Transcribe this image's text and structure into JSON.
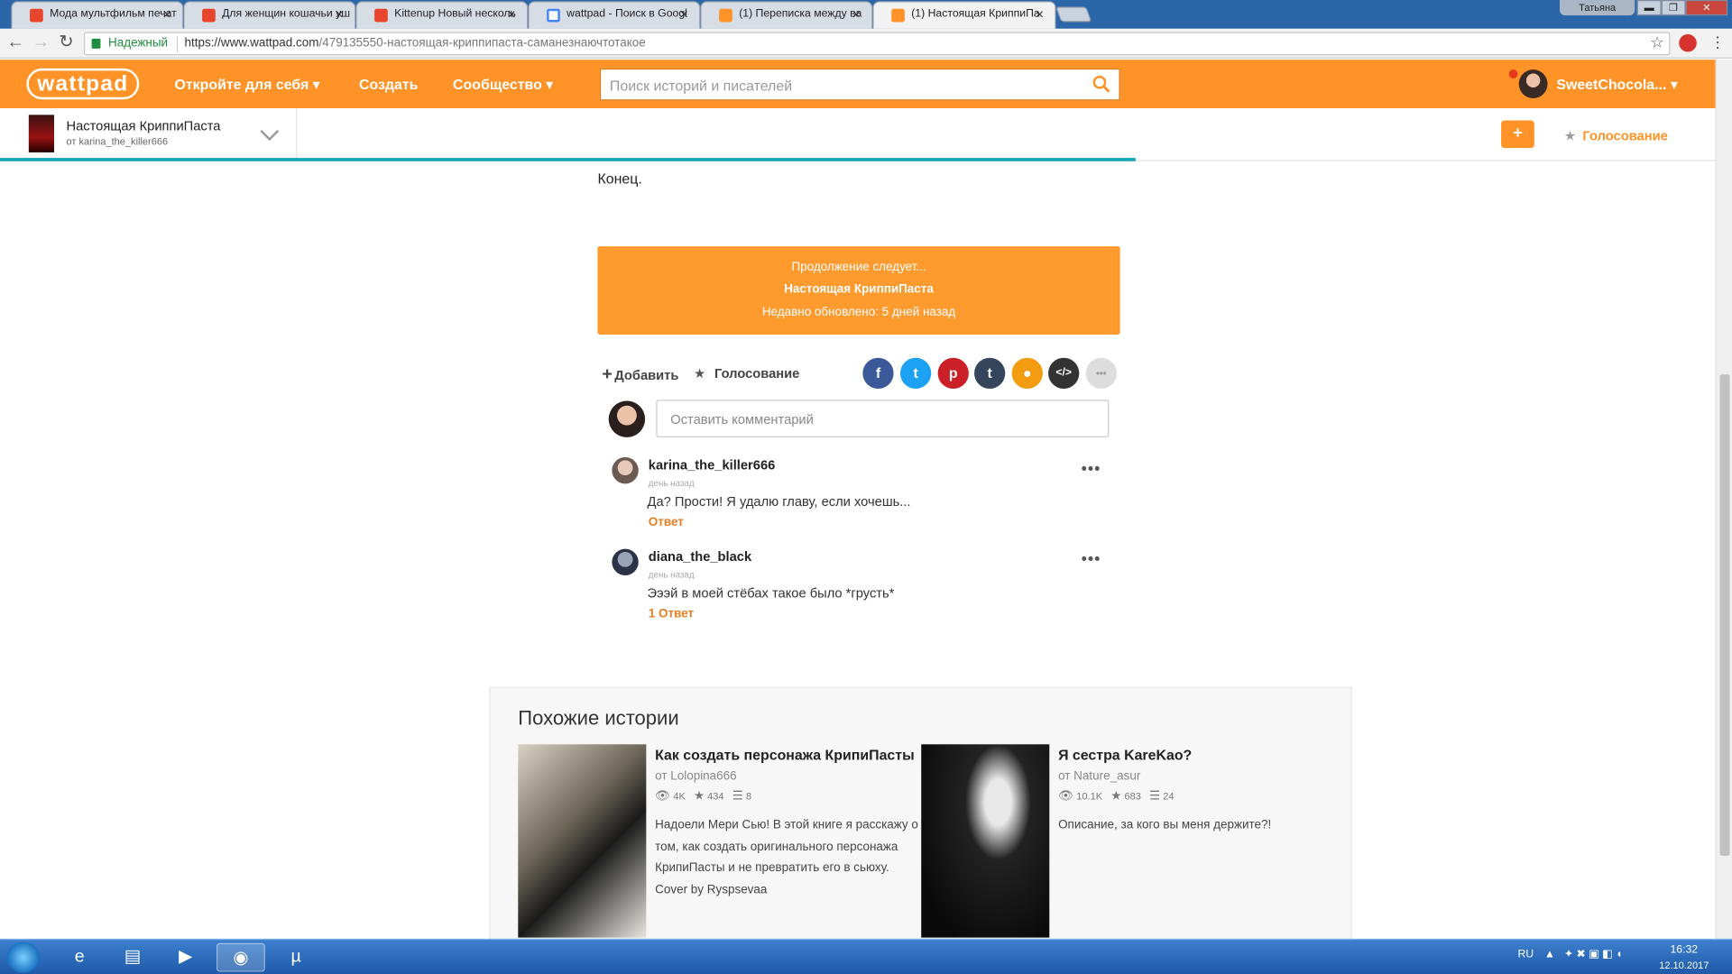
{
  "browser": {
    "tabs": [
      {
        "label": "Мода мультфильм печат",
        "close": "×"
      },
      {
        "label": "Для женщин кошачьи уш",
        "close": "×"
      },
      {
        "label": "Kittenup Новый несколь",
        "close": "×"
      },
      {
        "label": "wattpad - Поиск в Googl",
        "close": "×"
      },
      {
        "label": "(1) Переписка между ва",
        "close": "×"
      },
      {
        "label": "(1) Настоящая КриппиПа",
        "close": "×"
      }
    ],
    "window_user": "Татьяна",
    "secure_label": "Надежный",
    "url_domain": "https://www.wattpad.com",
    "url_path": "/479135550-настоящая-криппипаста-саманезнаючтотакое",
    "colors": {
      "tabbar": "#2a66a8",
      "secure": "#1e8e3e"
    }
  },
  "header": {
    "logo": "wattpad",
    "nav": {
      "discover": "Откройте для себя ▾",
      "create": "Создать",
      "community": "Сообщество ▾"
    },
    "search_placeholder": "Поиск историй и писателей",
    "username": "SweetChocola... ▾",
    "accent": "#ff9327"
  },
  "storybar": {
    "title": "Настоящая КриппиПаста",
    "author": "от karina_the_killer666",
    "plus": "+",
    "vote": "Голосование"
  },
  "content": {
    "ending": "Конец.",
    "banner": {
      "line1": "Продолжение следует...",
      "title": "Настоящая КриппиПаста",
      "updated": "Недавно обновлено: 5 дней назад"
    },
    "actions": {
      "add": "Добавить",
      "vote": "Голосование"
    },
    "share": [
      {
        "icon": "facebook-icon",
        "glyph": "f",
        "color": "#3b5998"
      },
      {
        "icon": "twitter-icon",
        "glyph": "t",
        "color": "#1da1f2"
      },
      {
        "icon": "pinterest-icon",
        "glyph": "p",
        "color": "#cb2027"
      },
      {
        "icon": "tumblr-icon",
        "glyph": "t",
        "color": "#35465c"
      },
      {
        "icon": "profile-icon",
        "glyph": "●",
        "color": "#f39c12"
      },
      {
        "icon": "embed-icon",
        "glyph": "</>",
        "color": "#333333"
      },
      {
        "icon": "more-icon",
        "glyph": "•••",
        "color": "#dddddd"
      }
    ],
    "comment_placeholder": "Оставить комментарий",
    "comments": [
      {
        "user": "karina_the_killer666",
        "time": "день назад",
        "text": "Да? Прости! Я удалю главу, если хочешь...",
        "reply": "Ответ",
        "more": "•••"
      },
      {
        "user": "diana_the_black",
        "time": "день назад",
        "text": "Эээй в моей стёбах такое было *грусть*",
        "reply": "1 Ответ",
        "more": "•••"
      }
    ]
  },
  "similar": {
    "title": "Похожие истории",
    "stories": [
      {
        "title": "Как создать персонажа КрипиПасты",
        "author": "от Lolopina666",
        "reads": "4K",
        "votes": "434",
        "parts": "8",
        "desc": "Надоели Мери Сью! В этой книге я расскажу о том, как создать оригинального персонажа КрипиПасты и не превратить его в сьюху. Cover by Ryspsevaa"
      },
      {
        "title": "Я сестра KareKao?",
        "author": "от Nature_asur",
        "reads": "10.1K",
        "votes": "683",
        "parts": "24",
        "desc": "Описание, за кого вы меня держите?!"
      }
    ]
  },
  "taskbar": {
    "lang": "RU",
    "time": "16:32",
    "date": "12.10.2017"
  }
}
